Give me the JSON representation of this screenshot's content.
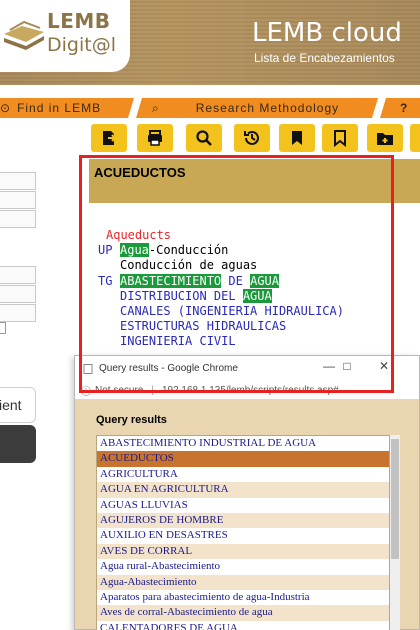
{
  "header": {
    "logo_line1": "LEMB",
    "logo_line2": "Digit@l",
    "cloud_title": "LEMB cloud",
    "cloud_subtitle": "Lista de Encabezamientos"
  },
  "tabs": [
    {
      "label": "Find in LEMB",
      "icon": "search-icon"
    },
    {
      "label": "Research Methodology",
      "icon": "search-icon"
    },
    {
      "label": "",
      "icon": "help-icon"
    }
  ],
  "toolbar": {
    "buttons": [
      "export-icon",
      "print-icon",
      "search-icon",
      "history-icon",
      "bookmark-filled-icon",
      "bookmark-outline-icon",
      "add-folder-icon"
    ]
  },
  "left_panel": {
    "button_label": "ient"
  },
  "record": {
    "heading": "ACUEDUCTOS",
    "english": "Aqueducts",
    "up_tag": "UP",
    "up_term1": "Agua",
    "up_term1_rest": "-Conducción",
    "up_term2": "Conducción de aguas",
    "tg_tag": "TG",
    "tg_term1_a": "ABASTECIMIENTO",
    "tg_term1_b": " DE ",
    "tg_term1_c": "AGUA",
    "tg_term2_a": "DISTRIBUCION DEL ",
    "tg_term2_b": "AGUA",
    "tg_term3": "CANALES (INGENIERIA HIDRAULICA)",
    "tg_term4": "ESTRUCTURAS HIDRAULICAS",
    "tg_term5": "INGENIERIA CIVIL"
  },
  "popup": {
    "window_title": "Query results - Google Chrome",
    "url_security": "Not secure",
    "url": "192.168.1.135/lemb/scripts/results.asp#",
    "heading": "Query results",
    "selected_index": 1,
    "items": [
      "ABASTECIMIENTO INDUSTRIAL DE AGUA",
      "ACUEDUCTOS",
      "AGRICULTURA",
      "AGUA EN AGRICULTURA",
      "AGUAS LLUVIAS",
      "AGUJEROS DE HOMBRE",
      "AUXILIO EN DESASTRES",
      "AVES DE CORRAL",
      "Agua rural-Abastecimiento",
      "Agua-Abastecimiento",
      "Aparatos para abastecimiento de agua-Industria",
      "Aves de corral-Abastecimiento de agua",
      "CALENTADORES DE AGUA"
    ]
  },
  "colors": {
    "header_gold": "#b4945f",
    "tab_orange": "#f08c20",
    "toolbar_yellow": "#f4c21d",
    "record_header": "#c8a855",
    "highlight_green": "#1a9a3a",
    "selection_frame": "#e82020",
    "list_selected": "#c8742f"
  }
}
